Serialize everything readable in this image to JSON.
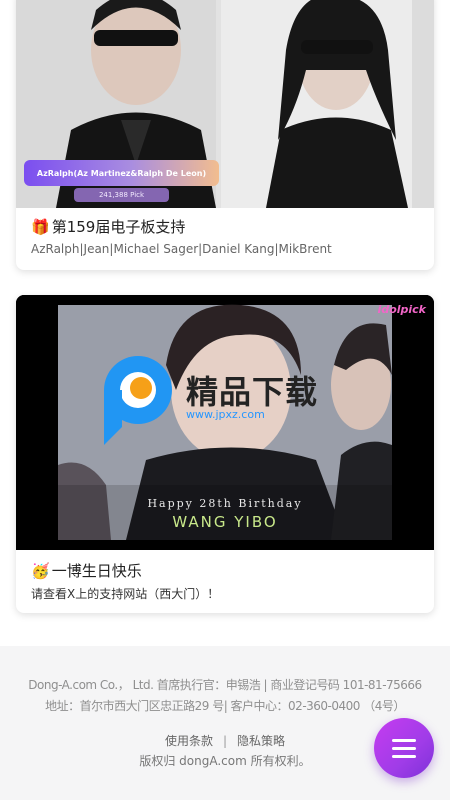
{
  "cards": [
    {
      "badge_text": "AzRalph(Az Martinez&Ralph De Leon)",
      "pick_text": "241,388 Pick",
      "title_icon": "gift-icon",
      "title_emoji": "🎁",
      "title": "第159届电子板支持",
      "subtitle": "AzRalph|Jean|Michael Sager|Daniel Kang|MikBrent"
    },
    {
      "watermark_logo": "idolpick",
      "watermark_text": "精品下载",
      "watermark_url": "www.jpxz.com",
      "caption_line1": "Happy 28th Birthday",
      "caption_line2": "WANG YIBO",
      "title_icon": "birthday-face-icon",
      "title_emoji": "🥳",
      "title": "一博生日快乐",
      "subtitle": "请查看X上的支持网站（西大门）！"
    }
  ],
  "footer": {
    "company_line": "Dong-A.com Co.， Ltd. 首席执行官：申锡浩  | 商业登记号码 101-81-75666",
    "address_line": "地址：首尔市西大门区忠正路29 号| 客户中心：02-360-0400 （4号）",
    "terms_link": "使用条款",
    "separator": "|",
    "privacy_link": "隐私策略",
    "copyright": "版权归 dongA.com 所有权利。"
  },
  "fab": {
    "icon": "menu-icon"
  },
  "colors": {
    "accent": "#a03ce8",
    "badge_start": "#7b4ef0",
    "badge_end": "#f2bd8f"
  }
}
